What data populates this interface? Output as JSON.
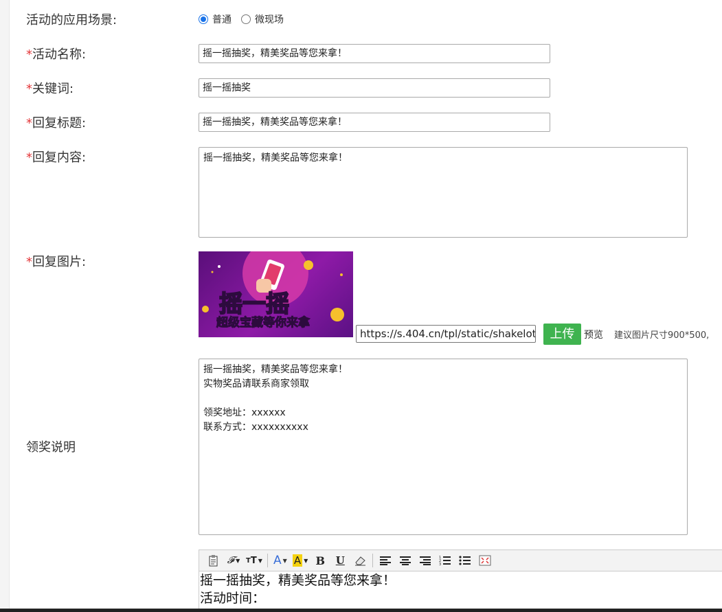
{
  "form": {
    "scene": {
      "label": "活动的应用场景:",
      "options": [
        {
          "label": "普通",
          "checked": true
        },
        {
          "label": "微现场",
          "checked": false
        }
      ]
    },
    "activity_name": {
      "required": "*",
      "label": "活动名称:",
      "value": "摇一摇抽奖，精美奖品等您来拿！"
    },
    "keyword": {
      "required": "*",
      "label": "关键词:",
      "value": "摇一摇抽奖"
    },
    "reply_title": {
      "required": "*",
      "label": "回复标题:",
      "value": "摇一摇抽奖，精美奖品等您来拿！"
    },
    "reply_content": {
      "required": "*",
      "label": "回复内容:",
      "value": "摇一摇抽奖，精美奖品等您来拿！"
    },
    "reply_image": {
      "required": "*",
      "label": "回复图片:",
      "banner_text_main": "摇一摇",
      "banner_text_sub_1": "超级",
      "banner_text_sub_2": "宝藏",
      "banner_text_sub_3": "等你来拿",
      "url": "https://s.404.cn/tpl/static/shakelott",
      "upload_label": "上传",
      "preview_label": "预览",
      "size_hint": "建议图片尺寸900*500,"
    },
    "prize_info": {
      "label": "领奖说明",
      "value": "摇一摇抽奖，精美奖品等您来拿！\n实物奖品请联系商家领取\n\n领奖地址：xxxxxx\n联系方式：xxxxxxxxxx"
    },
    "editor": {
      "toolbar": [
        "paste-icon",
        "font-family-icon",
        "font-size-icon",
        "font-color-icon",
        "highlight-icon",
        "bold-icon",
        "underline-icon",
        "eraser-icon",
        "align-left-icon",
        "align-center-icon",
        "align-right-icon",
        "ordered-list-icon",
        "unordered-list-icon",
        "fullscreen-icon"
      ],
      "line1": "摇一摇抽奖，精美奖品等您来拿！",
      "line2": "活动时间："
    }
  },
  "colors": {
    "required": "#e4393c",
    "upload": "#3fb34f",
    "radio": "#1a73e8"
  }
}
